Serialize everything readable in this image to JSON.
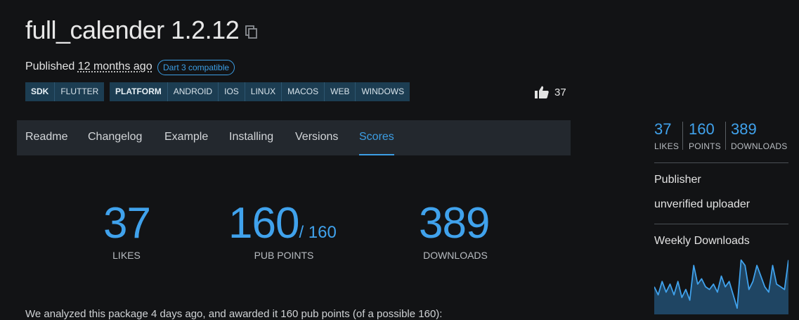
{
  "header": {
    "title": "full_calender 1.2.12",
    "published_prefix": "Published",
    "published_when": "12 months ago",
    "dart3_badge": "Dart 3 compatible"
  },
  "tags": {
    "sdk": [
      "SDK",
      "FLUTTER"
    ],
    "platform": [
      "PLATFORM",
      "ANDROID",
      "IOS",
      "LINUX",
      "MACOS",
      "WEB",
      "WINDOWS"
    ]
  },
  "like_button": {
    "count": "37",
    "icon": "thumb-up-icon"
  },
  "tabs": [
    {
      "label": "Readme"
    },
    {
      "label": "Changelog"
    },
    {
      "label": "Example"
    },
    {
      "label": "Installing"
    },
    {
      "label": "Versions"
    },
    {
      "label": "Scores"
    }
  ],
  "active_tab": "Scores",
  "scores": {
    "likes": {
      "value": "37",
      "label": "LIKES"
    },
    "pub_points": {
      "value": "160",
      "max": "/ 160",
      "label": "PUB POINTS"
    },
    "downloads": {
      "value": "389",
      "label": "DOWNLOADS"
    }
  },
  "bottom_text": "We analyzed this package 4 days ago, and awarded it 160 pub points (of a possible 160):",
  "sidebar": {
    "stats": [
      {
        "num": "37",
        "label": "LIKES"
      },
      {
        "num": "160",
        "label": "POINTS"
      },
      {
        "num": "389",
        "label": "DOWNLOADS"
      }
    ],
    "publisher_heading": "Publisher",
    "publisher_value": "unverified uploader",
    "weekly_heading": "Weekly Downloads",
    "weekly_trend": [
      0.45,
      0.3,
      0.55,
      0.35,
      0.5,
      0.3,
      0.55,
      0.25,
      0.4,
      0.2,
      0.85,
      0.5,
      0.6,
      0.45,
      0.4,
      0.5,
      0.35,
      0.65,
      0.45,
      0.55,
      0.3,
      0.05,
      0.95,
      0.85,
      0.4,
      0.55,
      0.85,
      0.65,
      0.45,
      0.35,
      0.85,
      0.5,
      0.45,
      0.4,
      0.95
    ]
  },
  "colors": {
    "accent": "#40a2ec",
    "background": "#121315",
    "tab_bar": "#23282e",
    "tag_bg": "#1c3d52"
  }
}
